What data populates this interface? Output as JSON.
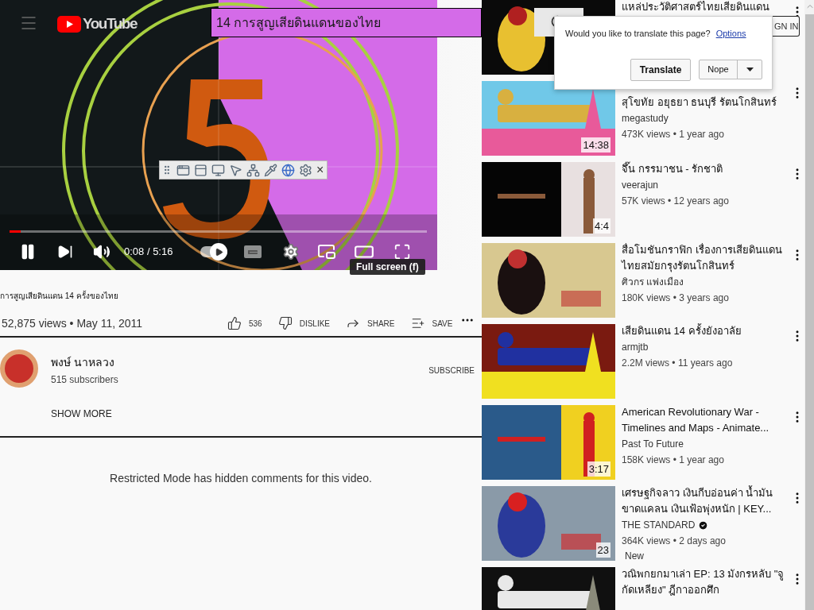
{
  "header": {
    "logo": "YouTube",
    "search": {
      "value": "14 การสูญเสียดินแดนของไทย"
    },
    "sign_in": "GN IN"
  },
  "player": {
    "progress": {
      "level": 0.027
    },
    "playing": true,
    "time": "0:08 / 5:16",
    "autoplay": true,
    "tooltip": "Full screen (f)",
    "toolbar_close": "×"
  },
  "video": {
    "title": "การสูญเสียดินแดน 14 ครั้งของไทย",
    "views_date": "52,875 views • May 11, 2011",
    "actions": [
      {
        "kind": "like",
        "label": "536"
      },
      {
        "kind": "dislike",
        "label": "DISLIKE"
      },
      {
        "kind": "share",
        "label": "SHARE"
      },
      {
        "kind": "save",
        "label": "SAVE"
      }
    ]
  },
  "channel": {
    "name": "พงษ์ นาหลวง",
    "subscribers": "515 subscribers",
    "subscribe": "SUBSCRIBE",
    "show_more": "SHOW MORE"
  },
  "comments": {
    "notice": "Restricted Mode has hidden comments for this video."
  },
  "translate_popup": {
    "prompt": "Would you like to translate this page?",
    "options": "Options",
    "translate": "Translate",
    "nope": "Nope"
  },
  "recommended": [
    {
      "kind": "title_only",
      "title": "แหล่ประวัติศาสตร์ไทยเสียดินแดน"
    },
    {
      "kind": "first_line_covered",
      "title": "สุโขทัย อยุธยา ธนบุรี รัตนโกสินทร์",
      "channel": "megastudy",
      "stats": "473K views • 1 year ago",
      "duration": "14:38"
    },
    {
      "kind": "full",
      "title": "จึ๊น กรรมาชน - รักชาติ",
      "channel": "veerajun",
      "stats": "57K views • 12 years ago",
      "duration": "4:4"
    },
    {
      "kind": "full",
      "title": "สื่อโมชันกราฟิก เรื่องการเสียดินแดนไทยสมัยกรุงรัตนโกสินทร์",
      "channel": "ศิวกร แพ่งเมือง",
      "stats": "180K views • 3 years ago"
    },
    {
      "kind": "full",
      "title": "เสียดินแดน 14 ครั้งยังอาลัย",
      "channel": "armjtb",
      "stats": "2.2M views • 11 years ago"
    },
    {
      "kind": "full",
      "title": "American Revolutionary War - Timelines and Maps - Animate...",
      "channel": "Past To Future",
      "stats": "158K views • 1 year ago",
      "duration": "3:17"
    },
    {
      "kind": "full",
      "title": "เศรษฐกิจลาว เงินกีบอ่อนค่า น้ำมันขาดแคลน เงินเฟ้อพุ่งหนัก | KEY...",
      "channel": "THE STANDARD",
      "verified": true,
      "stats": "364K views • 2 days ago",
      "badge": "New",
      "duration": "23"
    },
    {
      "kind": "full",
      "title": "วณิพกยกมาเล่า EP: 13 มังกรหลับ \"จูกัดเหลียง\" ฎีกาออกศึก"
    }
  ]
}
